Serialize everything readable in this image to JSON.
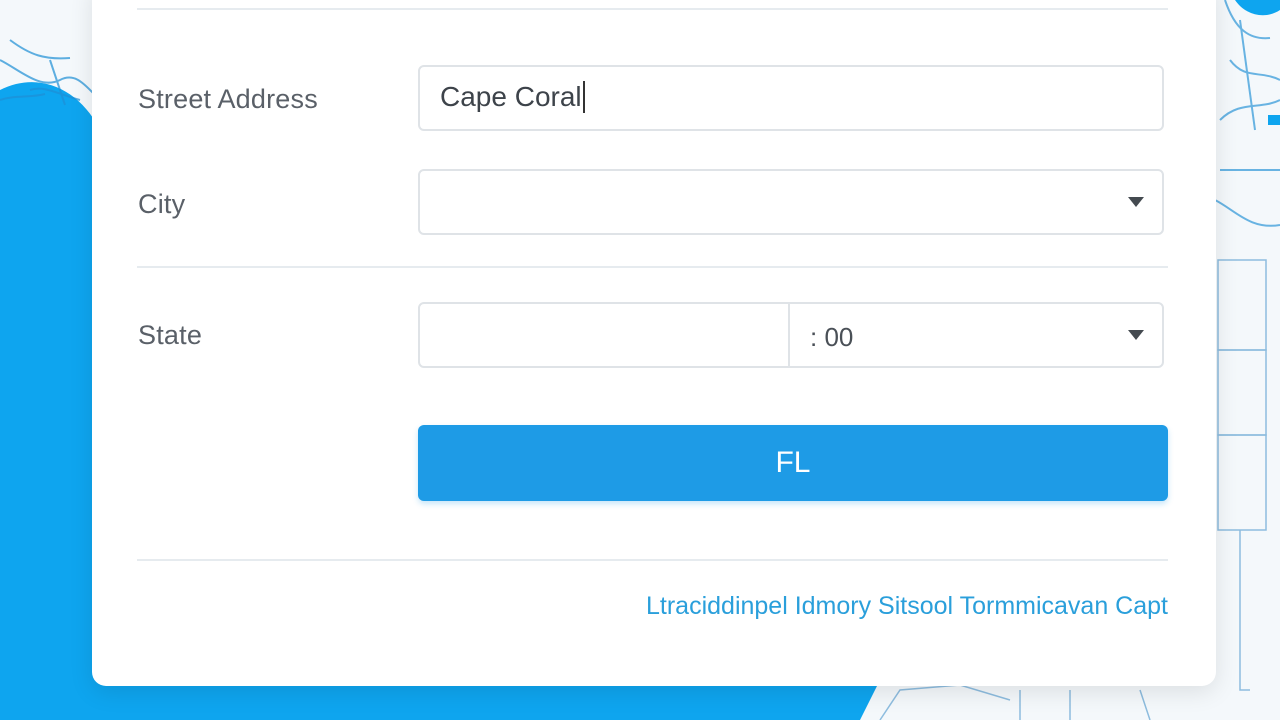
{
  "colors": {
    "accent": "#1e9be6",
    "link": "#2a9fdb",
    "background_blue": "#0ea5ef"
  },
  "form": {
    "street_address": {
      "label": "Street Address",
      "value": "Cape Coral"
    },
    "city": {
      "label": "City",
      "value": "",
      "icon": "chevron-down-icon"
    },
    "state": {
      "label": "State",
      "value_left": "",
      "value_right": ": 00",
      "icon": "chevron-down-icon"
    },
    "submit_label": "FL"
  },
  "footer": {
    "link_text": "Ltraciddinpel Idmory Sitsool Tormmicavan Capt"
  }
}
